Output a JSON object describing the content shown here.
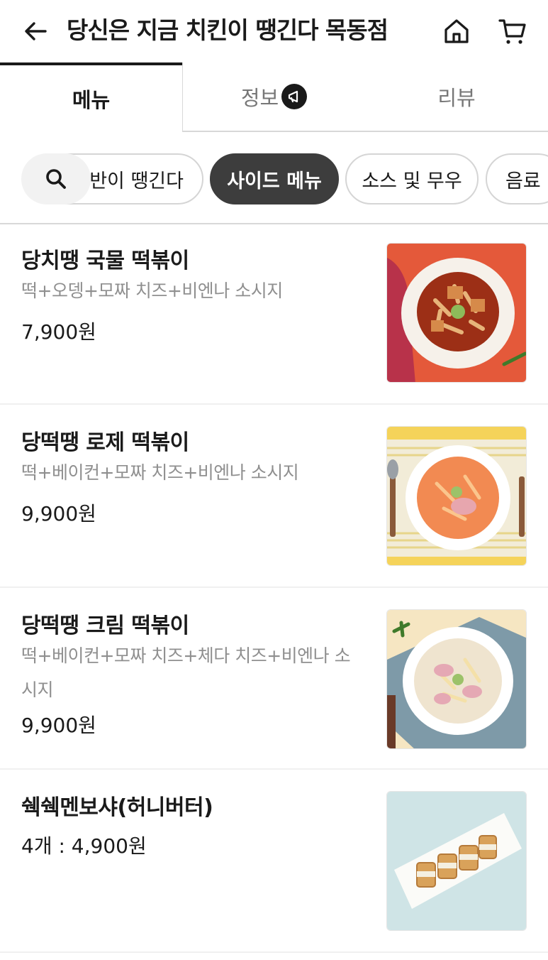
{
  "header": {
    "title": "당신은 지금 치킨이 땡긴다 목동점",
    "back_icon": "arrow-left-icon",
    "home_icon": "home-icon",
    "cart_icon": "cart-icon"
  },
  "tabs": [
    {
      "label": "메뉴",
      "active": true
    },
    {
      "label": "정보",
      "active": false,
      "icon": "megaphone-icon"
    },
    {
      "label": "리뷰",
      "active": false
    }
  ],
  "categories": [
    {
      "label": "반이 땡긴다",
      "active": false
    },
    {
      "label": "사이드 메뉴",
      "active": true
    },
    {
      "label": "소스 및 무우",
      "active": false
    },
    {
      "label": "음료",
      "active": false
    }
  ],
  "menu_items": [
    {
      "name": "당치땡 국물 떡볶이",
      "description": "떡+오뎅+모짜 치즈+비엔나 소시지",
      "price": "7,900원"
    },
    {
      "name": "당떡땡 로제 떡볶이",
      "description": "떡+베이컨+모짜 치즈+비엔나 소시지",
      "price": "9,900원"
    },
    {
      "name": "당떡땡 크림 떡볶이",
      "description": "떡+베이컨+모짜 치즈+체다 치즈+비엔나 소시지",
      "price": "9,900원"
    },
    {
      "name": "쉑쉑멘보샤(허니버터)",
      "description": "",
      "price": "4개 : 4,900원"
    }
  ],
  "colors": {
    "text_primary": "#1a1a1a",
    "text_secondary": "#8f8f8f",
    "chip_active_bg": "#3d3d3d",
    "divider": "#d8d8d8"
  }
}
